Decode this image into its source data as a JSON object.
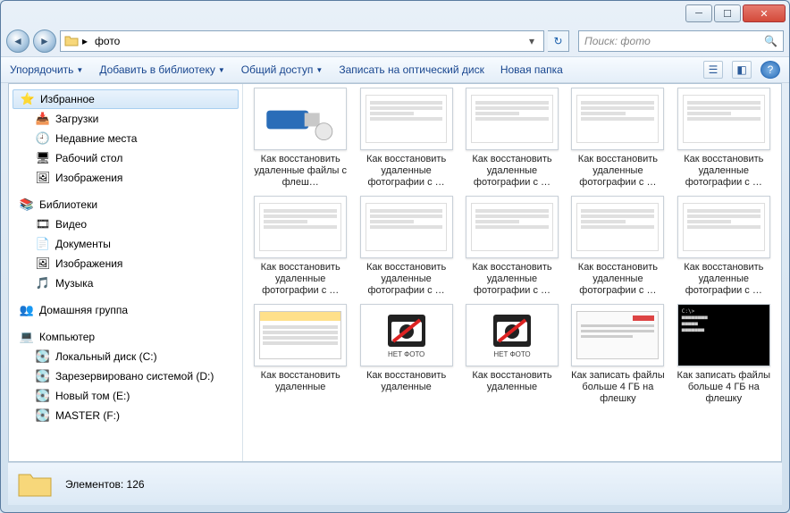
{
  "title": "",
  "address": {
    "folder": "фото"
  },
  "search": {
    "placeholder": "Поиск: фото"
  },
  "toolbar": {
    "organize": "Упорядочить",
    "addlib": "Добавить в библиотеку",
    "share": "Общий доступ",
    "burn": "Записать на оптический диск",
    "newfolder": "Новая папка"
  },
  "sidebar": {
    "favorites": {
      "label": "Избранное",
      "items": [
        {
          "label": "Загрузки"
        },
        {
          "label": "Недавние места"
        },
        {
          "label": "Рабочий стол"
        },
        {
          "label": "Изображения"
        }
      ]
    },
    "libraries": {
      "label": "Библиотеки",
      "items": [
        {
          "label": "Видео"
        },
        {
          "label": "Документы"
        },
        {
          "label": "Изображения"
        },
        {
          "label": "Музыка"
        }
      ]
    },
    "homegroup": {
      "label": "Домашняя группа"
    },
    "computer": {
      "label": "Компьютер",
      "items": [
        {
          "label": "Локальный диск (C:)"
        },
        {
          "label": "Зарезервировано системой (D:)"
        },
        {
          "label": "Новый том (E:)"
        },
        {
          "label": "MASTER (F:)"
        }
      ]
    }
  },
  "files": [
    {
      "label": "Как восстановить удаленные файлы с флеш…",
      "thumb": "usb"
    },
    {
      "label": "Как восстановить удаленные фотографии с …",
      "thumb": "doc"
    },
    {
      "label": "Как восстановить удаленные фотографии с …",
      "thumb": "doc"
    },
    {
      "label": "Как восстановить удаленные фотографии с …",
      "thumb": "doc"
    },
    {
      "label": "Как восстановить удаленные фотографии с …",
      "thumb": "doc"
    },
    {
      "label": "Как восстановить удаленные фотографии с …",
      "thumb": "app"
    },
    {
      "label": "Как восстановить удаленные фотографии с …",
      "thumb": "app"
    },
    {
      "label": "Как восстановить удаленные фотографии с …",
      "thumb": "app"
    },
    {
      "label": "Как восстановить удаленные фотографии с …",
      "thumb": "app"
    },
    {
      "label": "Как восстановить удаленные фотографии с …",
      "thumb": "app"
    },
    {
      "label": "Как восстановить удаленные",
      "thumb": "list"
    },
    {
      "label": "Как восстановить удаленные",
      "thumb": "nophoto"
    },
    {
      "label": "Как восстановить удаленные",
      "thumb": "nophoto"
    },
    {
      "label": "Как записать файлы больше 4 ГБ на флешку",
      "thumb": "dialog"
    },
    {
      "label": "Как записать файлы больше 4 ГБ на флешку",
      "thumb": "cmd"
    }
  ],
  "status": {
    "count_label": "Элементов:",
    "count": "126"
  },
  "nophoto_text": "НЕТ ФОТО"
}
